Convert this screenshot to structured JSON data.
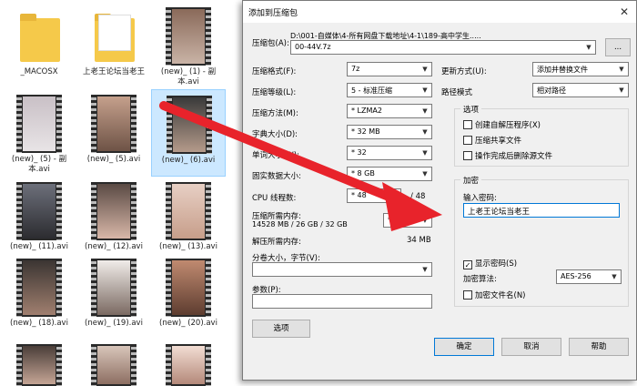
{
  "files": [
    {
      "label": "_MACOSX",
      "kind": "folder"
    },
    {
      "label": "上老王论坛当老王",
      "kind": "folder"
    },
    {
      "label": "(new)_ (1) - 副本.avi",
      "kind": "video"
    },
    {
      "label": "(new)_ (5) - 副本.avi",
      "kind": "video"
    },
    {
      "label": "(new)_ (5).avi",
      "kind": "video"
    },
    {
      "label": "(new)_ (6).avi",
      "kind": "video",
      "selected": true
    },
    {
      "label": "(new)_ (11).avi",
      "kind": "video"
    },
    {
      "label": "(new)_ (12).avi",
      "kind": "video"
    },
    {
      "label": "(new)_ (13).avi",
      "kind": "video"
    },
    {
      "label": "(new)_ (18).avi",
      "kind": "video"
    },
    {
      "label": "(new)_ (19).avi",
      "kind": "video"
    },
    {
      "label": "(new)_ (20).avi",
      "kind": "video"
    }
  ],
  "dialog": {
    "title": "添加到压缩包",
    "close_glyph": "✕",
    "archive_label": "压缩包(A):",
    "archive_path": "D:\\001-自媒体\\4-所有网盘下载地址\\4-1\\189-高中学生.....",
    "archive_name": "00-44V.7z",
    "browse_label": "...",
    "format_label": "压缩格式(F):",
    "format_value": "7z",
    "level_label": "压缩等级(L):",
    "level_value": "5 - 标准压缩",
    "method_label": "压缩方法(M):",
    "method_value": "* LZMA2",
    "dict_label": "字典大小(D):",
    "dict_value": "* 32 MB",
    "word_label": "单词大小(W):",
    "word_value": "* 32",
    "solid_label": "固实数据大小:",
    "solid_value": "* 8 GB",
    "cpu_label": "CPU 线程数:",
    "cpu_value": "* 48",
    "cpu_total": "/ 48",
    "mem_label": "压缩所需内存:",
    "mem_detail": "14528 MB / 26 GB / 32 GB",
    "mem_value": "* 80%",
    "decomp_label": "解压所需内存:",
    "decomp_value": "34 MB",
    "split_label": "分卷大小，字节(V):",
    "params_label": "参数(P):",
    "options_button": "选项",
    "update_label": "更新方式(U):",
    "update_value": "添加并替换文件",
    "path_label": "路径模式",
    "path_value": "相对路径",
    "options_group": "选项",
    "opt_sfx": "创建自解压程序(X)",
    "opt_shared": "压缩共享文件",
    "opt_delete": "操作完成后删除源文件",
    "enc_group": "加密",
    "enc_pw_label": "输入密码:",
    "enc_pw_value": "上老王论坛当老王",
    "show_pw": "显示密码(S)",
    "enc_method_label": "加密算法:",
    "enc_method_value": "AES-256",
    "enc_names": "加密文件名(N)",
    "ok": "确定",
    "cancel": "取消",
    "help": "帮助"
  },
  "colors": {
    "arrow": "#e8232b",
    "selection": "#cce8ff",
    "folder": "#f5c94a"
  }
}
